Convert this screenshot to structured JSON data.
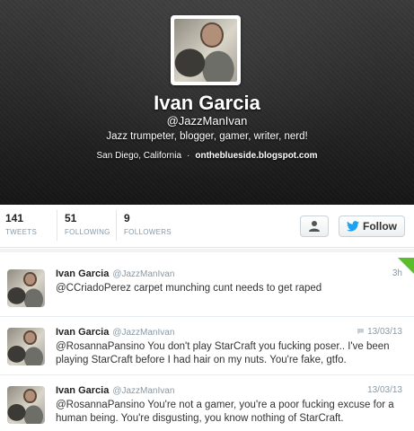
{
  "profile": {
    "name": "Ivan Garcia",
    "handle": "@JazzManIvan",
    "bio": "Jazz trumpeter, blogger, gamer, writer, nerd!",
    "location": "San Diego, California",
    "separator": "·",
    "url": "ontheblueside.blogspot.com",
    "avatar_icon": "profile-photo"
  },
  "stats": [
    {
      "count": "141",
      "label": "TWEETS"
    },
    {
      "count": "51",
      "label": "FOLLOWING"
    },
    {
      "count": "9",
      "label": "FOLLOWERS"
    }
  ],
  "actions": {
    "person_icon": "person-icon",
    "follow_label": "Follow",
    "follow_icon": "twitter-bird-icon"
  },
  "tweets": [
    {
      "name": "Ivan Garcia",
      "handle": "@JazzManIvan",
      "time": "3h",
      "text": "@CCriadoPerez carpet munching cunt needs to get raped",
      "corner_badge": true
    },
    {
      "name": "Ivan Garcia",
      "handle": "@JazzManIvan",
      "time": "13/03/13",
      "reply_icon": true,
      "text": "@RosannaPansino You don't play StarCraft you fucking poser.. I've been playing StarCraft before I had hair on my nuts. You're fake, gtfo."
    },
    {
      "name": "Ivan Garcia",
      "handle": "@JazzManIvan",
      "time": "13/03/13",
      "text": "@RosannaPansino You're not a gamer, you're a poor fucking excuse for a human being. You're disgusting, you know nothing of StarCraft."
    }
  ],
  "colors": {
    "accent": "#1da1f2",
    "muted": "#8899a6",
    "corner_badge": "#5bbd2c"
  }
}
